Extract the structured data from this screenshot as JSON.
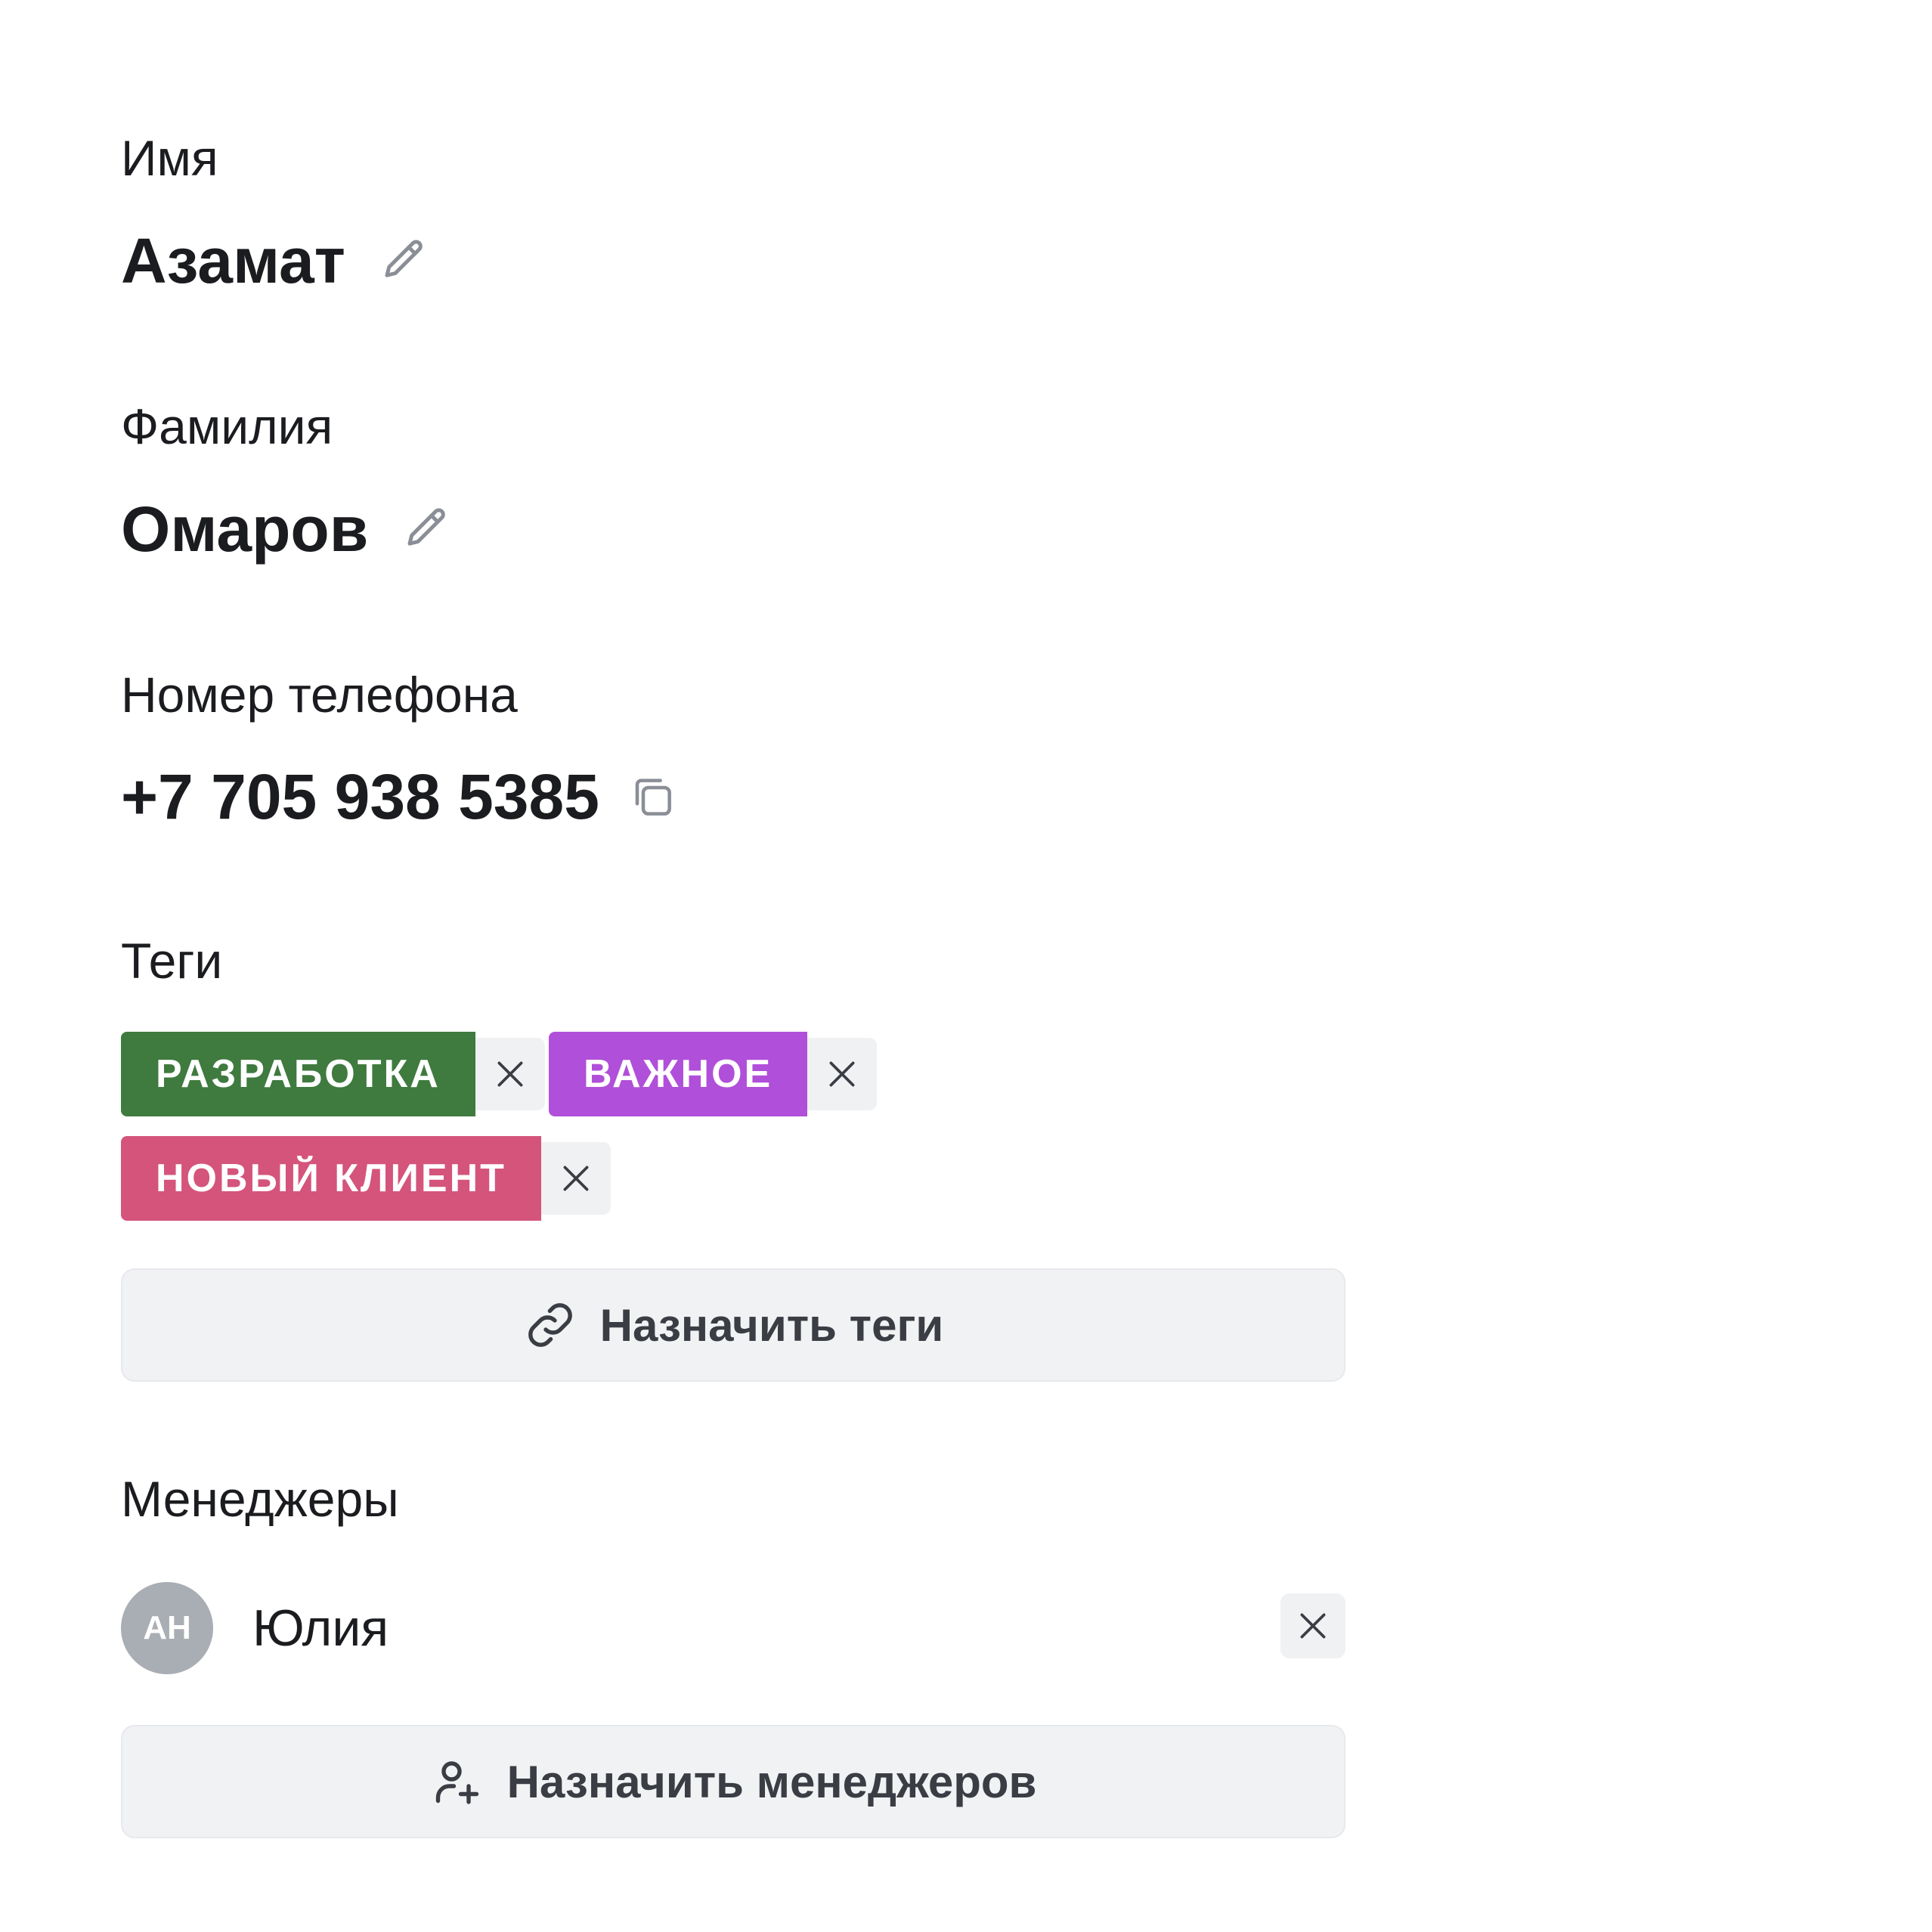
{
  "fields": {
    "first_name": {
      "label": "Имя",
      "value": "Азамат",
      "icon": "pencil-icon"
    },
    "last_name": {
      "label": "Фамилия",
      "value": "Омаров",
      "icon": "pencil-icon"
    },
    "phone": {
      "label": "Номер телефона",
      "value": "+7 705 938 5385",
      "icon": "copy-icon"
    }
  },
  "tags": {
    "label": "Теги",
    "items": [
      {
        "label": "РАЗРАБОТКА",
        "color": "#3f7a3e"
      },
      {
        "label": "ВАЖНОЕ",
        "color": "#b04fd9"
      },
      {
        "label": "НОВЫЙ КЛИЕНТ",
        "color": "#d4547c"
      }
    ],
    "assign_button": "Назначить теги"
  },
  "managers": {
    "label": "Менеджеры",
    "items": [
      {
        "initials": "АН",
        "name": "Юлия"
      }
    ],
    "assign_button": "Назначить менеджеров"
  }
}
